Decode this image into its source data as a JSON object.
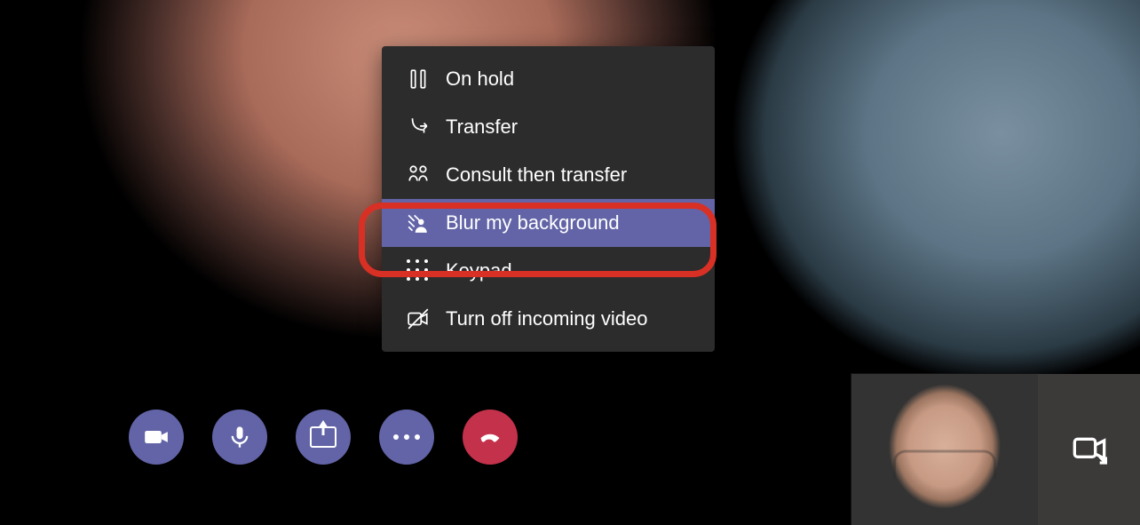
{
  "menu": {
    "items": [
      {
        "label": "On hold",
        "icon": "pause-icon",
        "selected": false
      },
      {
        "label": "Transfer",
        "icon": "transfer-icon",
        "selected": false
      },
      {
        "label": "Consult then transfer",
        "icon": "consult-transfer-icon",
        "selected": false
      },
      {
        "label": "Blur my background",
        "icon": "blur-background-icon",
        "selected": true
      },
      {
        "label": "Keypad",
        "icon": "keypad-icon",
        "selected": false
      },
      {
        "label": "Turn off incoming video",
        "icon": "video-off-icon",
        "selected": false
      }
    ]
  },
  "call_toolbar": {
    "camera_label": "Camera",
    "mic_label": "Microphone",
    "share_label": "Share",
    "more_label": "More actions",
    "hangup_label": "Hang up"
  }
}
